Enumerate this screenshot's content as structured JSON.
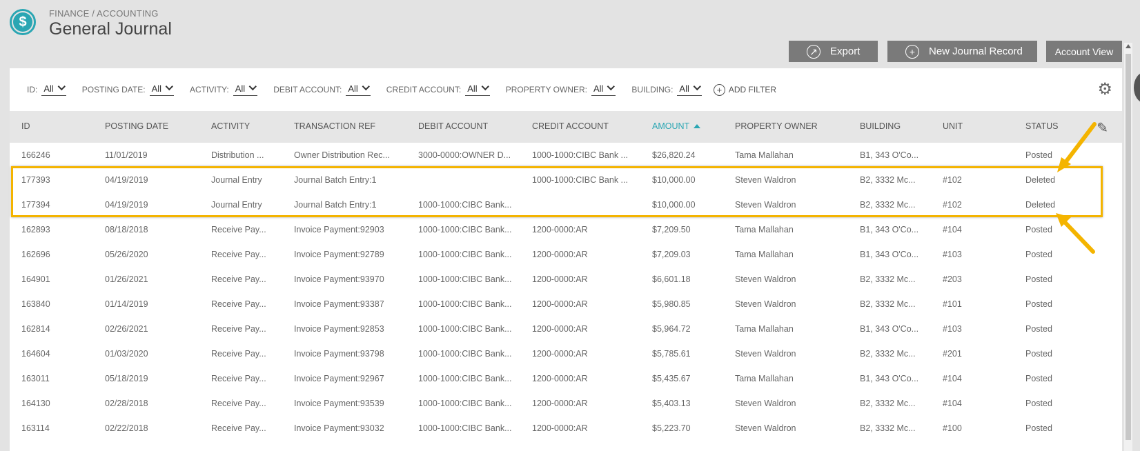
{
  "header": {
    "breadcrumb": "FINANCE / ACCOUNTING",
    "title": "General Journal",
    "logo_glyph": "$"
  },
  "toolbar": {
    "export_label": "Export",
    "new_record_label": "New Journal Record",
    "account_view_label": "Account View"
  },
  "filters": [
    {
      "label": "ID:",
      "value": "All"
    },
    {
      "label": "POSTING DATE:",
      "value": "All"
    },
    {
      "label": "ACTIVITY:",
      "value": "All"
    },
    {
      "label": "DEBIT ACCOUNT:",
      "value": "All"
    },
    {
      "label": "CREDIT ACCOUNT:",
      "value": "All"
    },
    {
      "label": "PROPERTY OWNER:",
      "value": "All"
    },
    {
      "label": "BUILDING:",
      "value": "All"
    }
  ],
  "add_filter_label": "ADD FILTER",
  "columns": [
    "ID",
    "POSTING DATE",
    "ACTIVITY",
    "TRANSACTION REF",
    "DEBIT ACCOUNT",
    "CREDIT ACCOUNT",
    "AMOUNT",
    "PROPERTY OWNER",
    "BUILDING",
    "UNIT",
    "STATUS"
  ],
  "sort": {
    "column": "AMOUNT",
    "direction": "ascending"
  },
  "rows": [
    [
      "166246",
      "11/01/2019",
      "Distribution ...",
      "Owner Distribution Rec...",
      "3000-0000:OWNER D...",
      "1000-1000:CIBC Bank ...",
      "$26,820.24",
      "Tama Mallahan",
      "B1, 343 O'Co...",
      "",
      "Posted"
    ],
    [
      "177393",
      "04/19/2019",
      "Journal Entry",
      "Journal Batch Entry:1",
      "",
      "1000-1000:CIBC Bank ...",
      "$10,000.00",
      "Steven Waldron",
      "B2, 3332 Mc...",
      "#102",
      "Deleted"
    ],
    [
      "177394",
      "04/19/2019",
      "Journal Entry",
      "Journal Batch Entry:1",
      "1000-1000:CIBC Bank...",
      "",
      "$10,000.00",
      "Steven Waldron",
      "B2, 3332 Mc...",
      "#102",
      "Deleted"
    ],
    [
      "162893",
      "08/18/2018",
      "Receive Pay...",
      "Invoice Payment:92903",
      "1000-1000:CIBC Bank...",
      "1200-0000:AR",
      "$7,209.50",
      "Tama Mallahan",
      "B1, 343 O'Co...",
      "#104",
      "Posted"
    ],
    [
      "162696",
      "05/26/2020",
      "Receive Pay...",
      "Invoice Payment:92789",
      "1000-1000:CIBC Bank...",
      "1200-0000:AR",
      "$7,209.03",
      "Tama Mallahan",
      "B1, 343 O'Co...",
      "#103",
      "Posted"
    ],
    [
      "164901",
      "01/26/2021",
      "Receive Pay...",
      "Invoice Payment:93970",
      "1000-1000:CIBC Bank...",
      "1200-0000:AR",
      "$6,601.18",
      "Steven Waldron",
      "B2, 3332 Mc...",
      "#203",
      "Posted"
    ],
    [
      "163840",
      "01/14/2019",
      "Receive Pay...",
      "Invoice Payment:93387",
      "1000-1000:CIBC Bank...",
      "1200-0000:AR",
      "$5,980.85",
      "Steven Waldron",
      "B2, 3332 Mc...",
      "#101",
      "Posted"
    ],
    [
      "162814",
      "02/26/2021",
      "Receive Pay...",
      "Invoice Payment:92853",
      "1000-1000:CIBC Bank...",
      "1200-0000:AR",
      "$5,964.72",
      "Tama Mallahan",
      "B1, 343 O'Co...",
      "#103",
      "Posted"
    ],
    [
      "164604",
      "01/03/2020",
      "Receive Pay...",
      "Invoice Payment:93798",
      "1000-1000:CIBC Bank...",
      "1200-0000:AR",
      "$5,785.61",
      "Steven Waldron",
      "B2, 3332 Mc...",
      "#201",
      "Posted"
    ],
    [
      "163011",
      "05/18/2019",
      "Receive Pay...",
      "Invoice Payment:92967",
      "1000-1000:CIBC Bank...",
      "1200-0000:AR",
      "$5,435.67",
      "Tama Mallahan",
      "B1, 343 O'Co...",
      "#104",
      "Posted"
    ],
    [
      "164130",
      "02/28/2018",
      "Receive Pay...",
      "Invoice Payment:93539",
      "1000-1000:CIBC Bank...",
      "1200-0000:AR",
      "$5,403.13",
      "Steven Waldron",
      "B2, 3332 Mc...",
      "#104",
      "Posted"
    ],
    [
      "163114",
      "02/22/2018",
      "Receive Pay...",
      "Invoice Payment:93032",
      "1000-1000:CIBC Bank...",
      "1200-0000:AR",
      "$5,223.70",
      "Steven Waldron",
      "B2, 3332 Mc...",
      "#100",
      "Posted"
    ]
  ],
  "icons": {
    "export": "export-icon",
    "new_record": "plus-circle-icon",
    "add_filter": "plus-circle-icon",
    "settings": "gear-icon",
    "edit_columns": "pencil-icon"
  },
  "colors": {
    "accent": "#2aa6b3",
    "button": "#7a7a7a",
    "highlight": "#f4b400"
  }
}
